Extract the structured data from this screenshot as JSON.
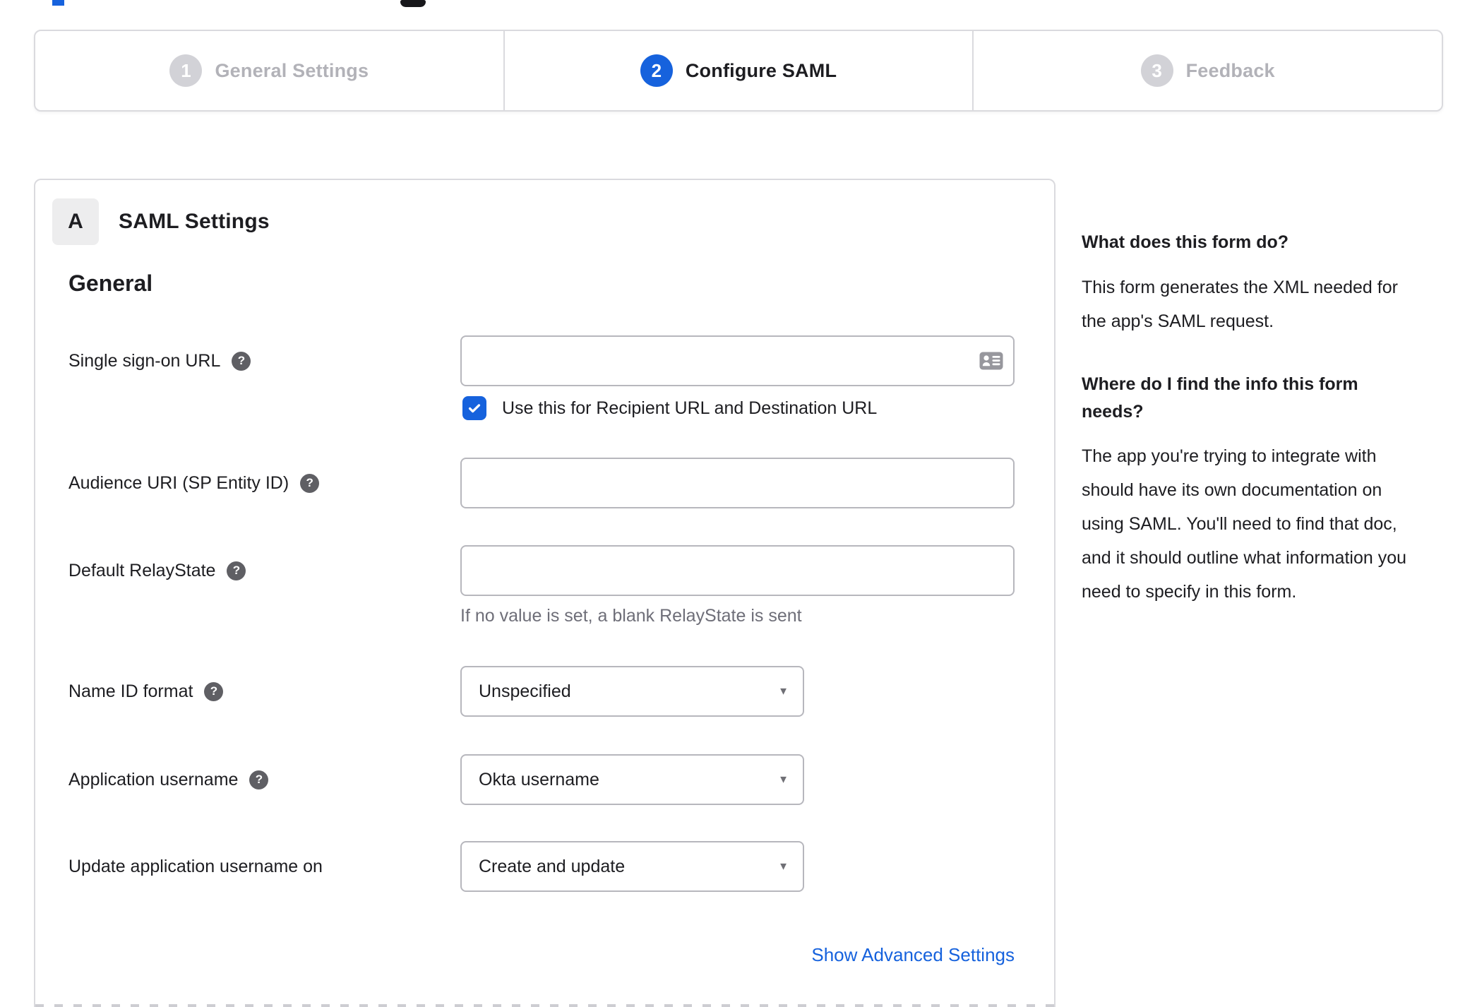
{
  "ui": {
    "help_glyph": "?",
    "caret_glyph": "▼"
  },
  "colors": {
    "accent_blue": "#1662dd",
    "inactive_step_gray": "#d2d2d7",
    "text_dark": "#1d1d21",
    "hint_gray": "#6e6e78"
  },
  "stepper": {
    "steps": [
      {
        "number": "1",
        "label": "General Settings",
        "state": "inactive"
      },
      {
        "number": "2",
        "label": "Configure SAML",
        "state": "active"
      },
      {
        "number": "3",
        "label": "Feedback",
        "state": "inactive"
      }
    ]
  },
  "card": {
    "badge": "A",
    "title": "SAML Settings",
    "section_heading": "General",
    "fields": {
      "sso": {
        "label": "Single sign-on URL",
        "value": "",
        "checkbox_label": "Use this for Recipient URL and Destination URL",
        "checkbox_checked": true
      },
      "audience": {
        "label": "Audience URI (SP Entity ID)",
        "value": ""
      },
      "relay_state": {
        "label": "Default RelayState",
        "value": "",
        "hint": "If no value is set, a blank RelayState is sent"
      },
      "name_id_format": {
        "label": "Name ID format",
        "value": "Unspecified"
      },
      "application_username": {
        "label": "Application username",
        "value": "Okta username"
      },
      "update_application_username_on": {
        "label": "Update application username on",
        "value": "Create and update"
      }
    },
    "advanced_link": "Show Advanced Settings"
  },
  "sidebar": {
    "sections": [
      {
        "heading": "What does this form do?",
        "body": "This form generates the XML needed for the app's SAML request."
      },
      {
        "heading": "Where do I find the info this form needs?",
        "body": "The app you're trying to integrate with should have its own documentation on using SAML. You'll need to find that doc, and it should outline what information you need to specify in this form."
      }
    ]
  }
}
